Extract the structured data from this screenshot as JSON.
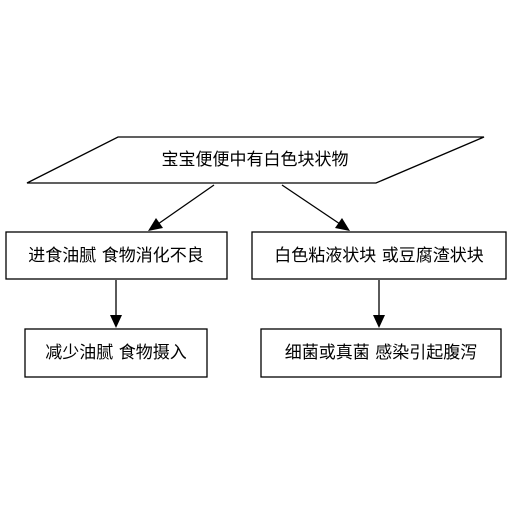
{
  "diagram": {
    "root": "宝宝便便中有白色块状物",
    "left_branch": {
      "cause": "进食油腻 食物消化不良",
      "advice": "减少油腻 食物摄入"
    },
    "right_branch": {
      "cause": "白色粘液状块 或豆腐渣状块",
      "advice": "细菌或真菌 感染引起腹泻"
    }
  }
}
